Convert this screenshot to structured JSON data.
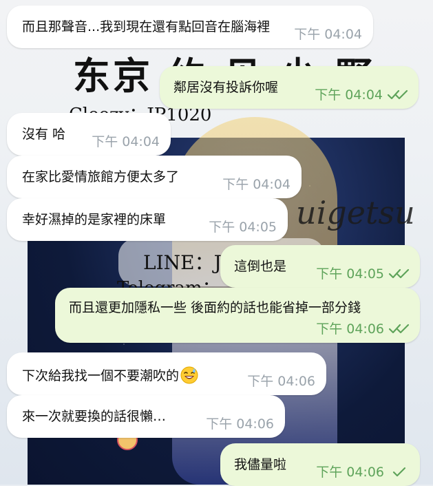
{
  "wallpaper": {
    "title": "东京 约 见 少 野",
    "handle": "Cleezy：JP1020",
    "script_text": "uigetsu",
    "line_id": "LINE：J",
    "telegram": "Telegram："
  },
  "messages": [
    {
      "direction": "in",
      "text": "而且那聲音...我到現在還有點回音在腦海裡",
      "time": "下午 04:04"
    },
    {
      "direction": "out",
      "text": "鄰居沒有投訴你喔",
      "time": "下午 04:04",
      "status": "read"
    },
    {
      "direction": "in",
      "text": "沒有 哈",
      "time": "下午 04:04"
    },
    {
      "direction": "in",
      "text": "在家比愛情旅館方便太多了",
      "time": "下午 04:04"
    },
    {
      "direction": "in",
      "text": "幸好濕掉的是家裡的床單",
      "time": "下午 04:05"
    },
    {
      "direction": "out",
      "text": "這倒也是",
      "time": "下午 04:05",
      "status": "read"
    },
    {
      "direction": "out",
      "text": "而且還更加隱私一些 後面約的話也能省掉一部分錢",
      "time": "下午 04:06",
      "status": "read"
    },
    {
      "direction": "in",
      "text": "下次給我找一個不要潮吹的",
      "emoji": "sweat-smile-emoji",
      "time": "下午 04:06"
    },
    {
      "direction": "in",
      "text": "來一次就要換的話很懶…",
      "time": "下午 04:06"
    },
    {
      "direction": "out",
      "text": "我儘量啦",
      "time": "下午 04:06",
      "status": "sent"
    }
  ],
  "colors": {
    "incoming_bubble": "#ffffff",
    "outgoing_bubble": "#ecf8d9",
    "outgoing_time": "#5ea35a",
    "incoming_time": "#9aa3ab",
    "check": "#5ea35a"
  }
}
